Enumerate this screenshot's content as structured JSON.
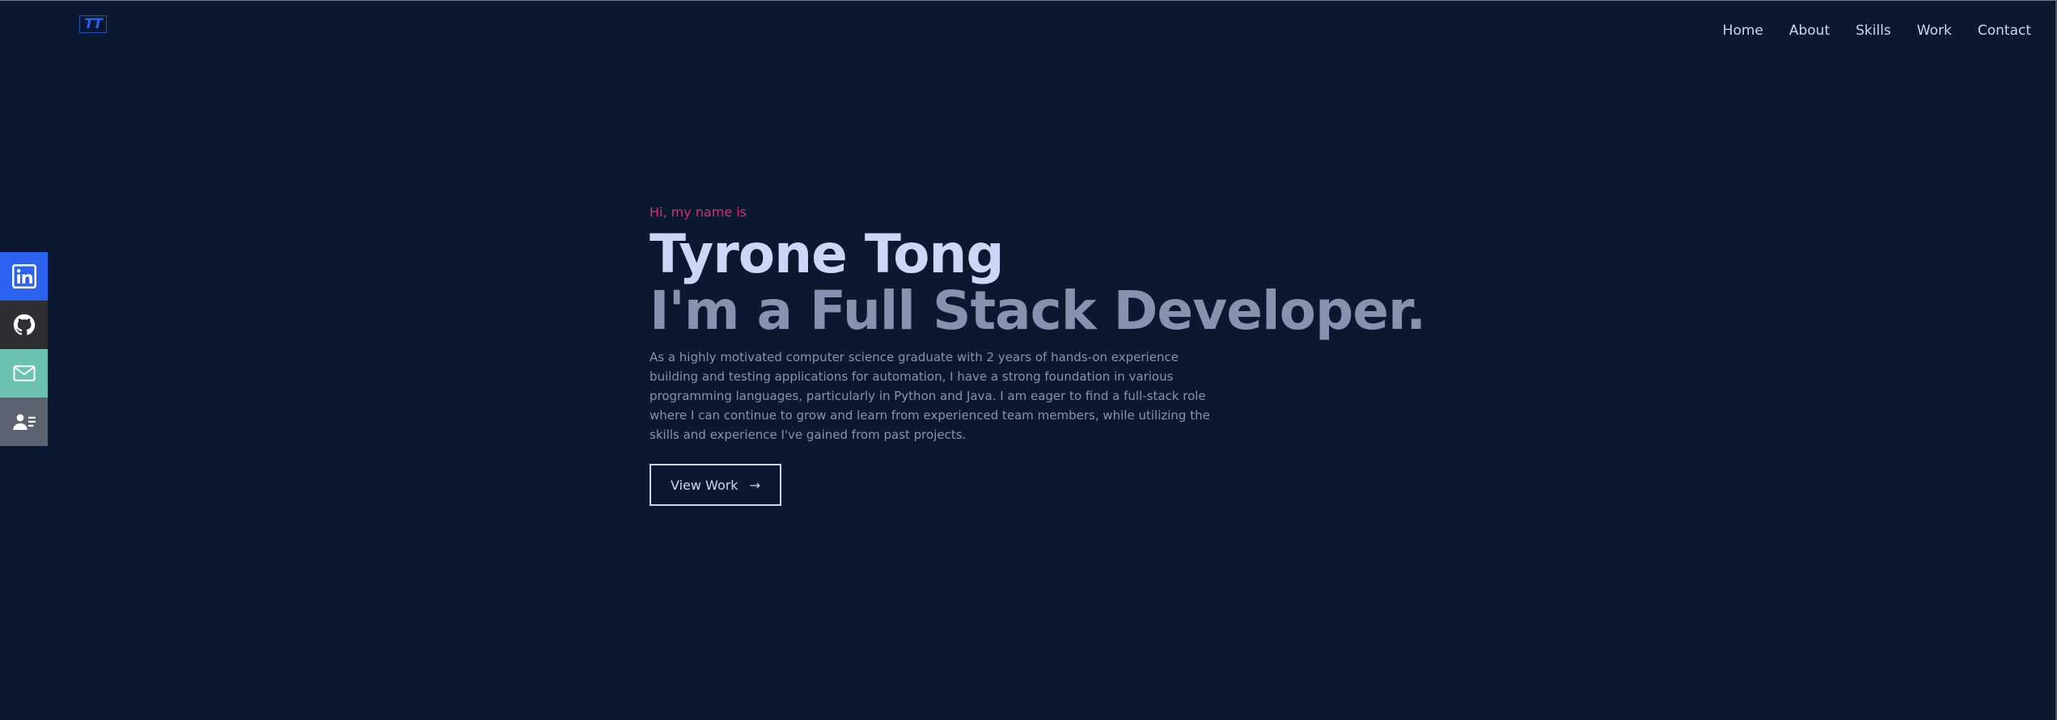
{
  "logo": {
    "text": "TT"
  },
  "nav": {
    "items": [
      {
        "label": "Home"
      },
      {
        "label": "About"
      },
      {
        "label": "Skills"
      },
      {
        "label": "Work"
      },
      {
        "label": "Contact"
      }
    ]
  },
  "social": {
    "items": [
      {
        "icon": "linkedin-icon",
        "color": "#2b63f0"
      },
      {
        "icon": "github-icon",
        "color": "#2f2f33"
      },
      {
        "icon": "mail-icon",
        "color": "#6cc2b0"
      },
      {
        "icon": "resume-icon",
        "color": "#5b6270"
      }
    ]
  },
  "hero": {
    "greeting": "Hi, my name is",
    "name": "Tyrone Tong",
    "role": "I'm a Full Stack Developer.",
    "description": "As a highly motivated computer science graduate with 2 years of hands-on experience building and testing applications for automation, I have a strong foundation in various programming languages, particularly in Python and Java. I am eager to find a full-stack role where I can continue to grow and learn from experienced team members, while utilizing the skills and experience I've gained from past projects.",
    "cta_label": "View Work",
    "cta_arrow": "→"
  },
  "colors": {
    "background": "#0a1930",
    "accent": "#e0287a",
    "primary_text": "#ccd6f6",
    "secondary_text": "#8892b0",
    "logo": "#2563eb"
  }
}
